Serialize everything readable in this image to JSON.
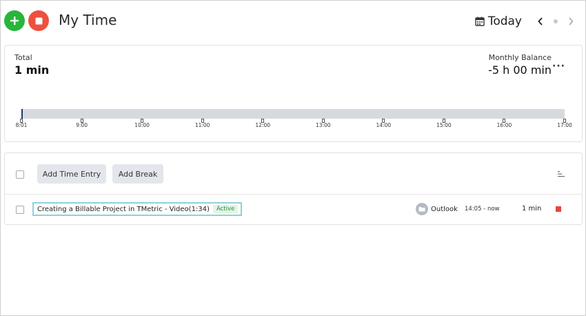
{
  "header": {
    "title": "My Time",
    "date_label": "Today"
  },
  "icons": {
    "add": "plus-icon",
    "stop": "stop-icon",
    "calendar": "calendar-icon",
    "prev": "chevron-left-icon",
    "next": "chevron-right-icon",
    "more": "ellipsis-icon",
    "sort": "sort-icon",
    "folder": "folder-icon"
  },
  "colors": {
    "add_button": "#27b53b",
    "stop_button": "#ef4f3f",
    "active_badge_bg": "#e2f5e3",
    "active_badge_text": "#2c8a3e",
    "selection_border": "#8fcfdf",
    "timeline_bar": "#d6d9de"
  },
  "summary": {
    "total_label": "Total",
    "total_value": "1 min",
    "balance_label": "Monthly Balance",
    "balance_value": "-5 h 00 min",
    "more_label": "···"
  },
  "timeline": {
    "ticks": [
      "8:01",
      "9:00",
      "10:00",
      "11:00",
      "12:00",
      "13:00",
      "14:00",
      "15:00",
      "16:00",
      "17:00"
    ]
  },
  "toolbar": {
    "add_entry_label": "Add Time Entry",
    "add_break_label": "Add Break"
  },
  "entries": [
    {
      "description": "Creating a Billable Project in TMetric - Video(1:34)",
      "status": "Active",
      "project": "Outlook",
      "time_range": "14:05 - now",
      "duration": "1 min"
    }
  ]
}
